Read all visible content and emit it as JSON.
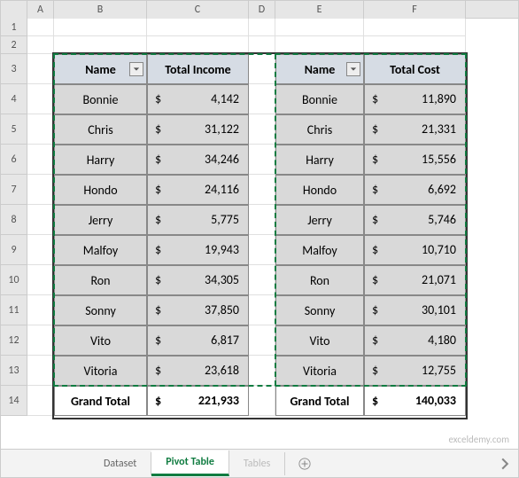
{
  "cols": [
    "A",
    "B",
    "C",
    "D",
    "E",
    "F"
  ],
  "rows": [
    "1",
    "2",
    "3",
    "4",
    "5",
    "6",
    "7",
    "8",
    "9",
    "10",
    "11",
    "12",
    "13",
    "14"
  ],
  "left": {
    "name_header": "Name",
    "value_header": "Total Income",
    "items": [
      {
        "name": "Bonnie",
        "value": "4,142"
      },
      {
        "name": "Chris",
        "value": "31,122"
      },
      {
        "name": "Harry",
        "value": "34,246"
      },
      {
        "name": "Hondo",
        "value": "24,116"
      },
      {
        "name": "Jerry",
        "value": "5,775"
      },
      {
        "name": "Malfoy",
        "value": "19,943"
      },
      {
        "name": "Ron",
        "value": "34,305"
      },
      {
        "name": "Sonny",
        "value": "37,850"
      },
      {
        "name": "Vito",
        "value": "6,817"
      },
      {
        "name": "Vitoria",
        "value": "23,618"
      }
    ],
    "total_label": "Grand Total",
    "total_value": "221,933"
  },
  "right": {
    "name_header": "Name",
    "value_header": "Total Cost",
    "items": [
      {
        "name": "Bonnie",
        "value": "11,890"
      },
      {
        "name": "Chris",
        "value": "21,331"
      },
      {
        "name": "Harry",
        "value": "15,556"
      },
      {
        "name": "Hondo",
        "value": "6,692"
      },
      {
        "name": "Jerry",
        "value": "5,746"
      },
      {
        "name": "Malfoy",
        "value": "10,710"
      },
      {
        "name": "Ron",
        "value": "21,071"
      },
      {
        "name": "Sonny",
        "value": "30,101"
      },
      {
        "name": "Vito",
        "value": "4,180"
      },
      {
        "name": "Vitoria",
        "value": "12,755"
      }
    ],
    "total_label": "Grand Total",
    "total_value": "140,033"
  },
  "currency": "$",
  "tabs": {
    "items": [
      "Dataset",
      "Pivot Table",
      "Tables"
    ],
    "active": 1
  },
  "watermark": "exceldemy.com"
}
